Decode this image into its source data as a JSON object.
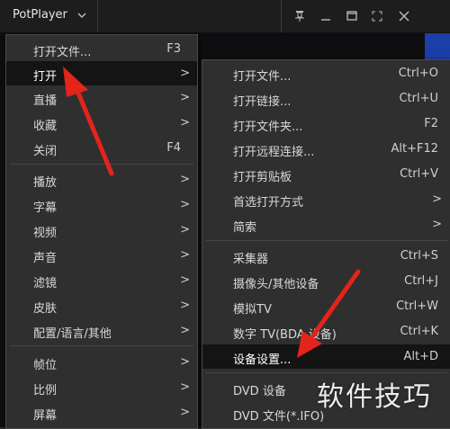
{
  "app": {
    "title": "PotPlayer"
  },
  "colors": {
    "menu_bg": "#2f2f2f",
    "highlight": "#141414",
    "arrow": "#e3241b",
    "video_strip": "#1c3ea8"
  },
  "icons": {
    "title_chevron": "chevron-down-icon",
    "pin": "pin-icon",
    "minimize": "minimize-icon",
    "maximize": "maximize-icon",
    "fullscreen": "fullscreen-icon",
    "close": "close-icon"
  },
  "menu1": {
    "items": [
      {
        "label": "打开文件...",
        "shortcut": "F3"
      },
      {
        "label": "打开",
        "arrow": ">"
      },
      {
        "label": "直播",
        "arrow": ">"
      },
      {
        "label": "收藏",
        "arrow": ">"
      },
      {
        "label": "关闭",
        "shortcut": "F4"
      },
      {
        "label": "播放",
        "arrow": ">"
      },
      {
        "label": "字幕",
        "arrow": ">"
      },
      {
        "label": "视频",
        "arrow": ">"
      },
      {
        "label": "声音",
        "arrow": ">"
      },
      {
        "label": "滤镜",
        "arrow": ">"
      },
      {
        "label": "皮肤",
        "arrow": ">"
      },
      {
        "label": "配置/语言/其他",
        "arrow": ">"
      },
      {
        "label": "帧位",
        "arrow": ">"
      },
      {
        "label": "比例",
        "arrow": ">"
      },
      {
        "label": "屏幕",
        "arrow": ">"
      }
    ]
  },
  "menu2": {
    "items": [
      {
        "label": "打开文件...",
        "shortcut": "Ctrl+O"
      },
      {
        "label": "打开链接...",
        "shortcut": "Ctrl+U"
      },
      {
        "label": "打开文件夹...",
        "shortcut": "F2"
      },
      {
        "label": "打开远程连接...",
        "shortcut": "Alt+F12"
      },
      {
        "label": "打开剪贴板",
        "shortcut": "Ctrl+V"
      },
      {
        "label": "首选打开方式",
        "arrow": ">"
      },
      {
        "label": "简索",
        "arrow": ">"
      },
      {
        "label": "采集器",
        "shortcut": "Ctrl+S"
      },
      {
        "label": "摄像头/其他设备",
        "shortcut": "Ctrl+J"
      },
      {
        "label": "模拟TV",
        "shortcut": "Ctrl+W"
      },
      {
        "label": "数字 TV(BDA 设备)",
        "shortcut": "Ctrl+K"
      },
      {
        "label": "设备设置...",
        "shortcut": "Alt+D"
      },
      {
        "label": "DVD 设备"
      },
      {
        "label": "DVD 文件(*.IFO)"
      }
    ]
  },
  "watermark": "软件技巧"
}
